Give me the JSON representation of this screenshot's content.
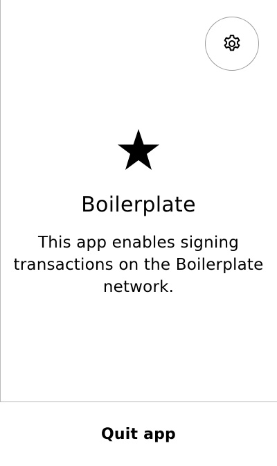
{
  "header": {
    "settings_icon": "gear-icon"
  },
  "app": {
    "icon": "star-icon",
    "name": "Boilerplate",
    "description": "This app enables signing transactions on the Boilerplate network."
  },
  "footer": {
    "quit_label": "Quit app"
  },
  "colors": {
    "background": "#ffffff",
    "text": "#000000",
    "border": "#b8b8b8",
    "settings_ring": "#9a9a9a"
  }
}
